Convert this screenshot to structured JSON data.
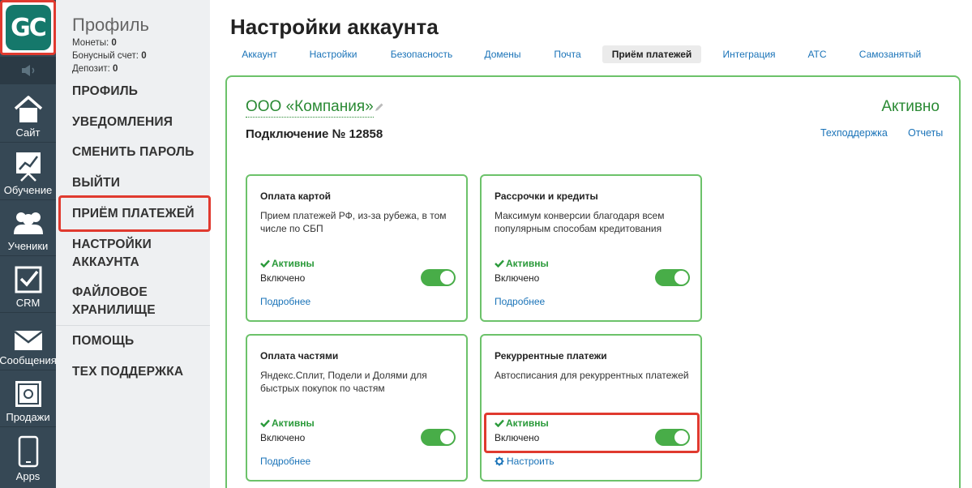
{
  "rail": {
    "logo_text": "GC",
    "items": [
      {
        "label": "Сайт",
        "icon": "house-icon"
      },
      {
        "label": "Обучение",
        "icon": "chart-board-icon"
      },
      {
        "label": "Ученики",
        "icon": "users-icon"
      },
      {
        "label": "CRM",
        "icon": "checkbox-icon"
      },
      {
        "label": "Сообщения",
        "icon": "envelope-icon"
      },
      {
        "label": "Продажи",
        "icon": "safe-icon"
      },
      {
        "label": "Apps",
        "icon": "smartphone-icon"
      }
    ]
  },
  "subnav": {
    "title": "Профиль",
    "coins_label": "Монеты:",
    "coins_value": "0",
    "bonus_label": "Бонусный счет:",
    "bonus_value": "0",
    "deposit_label": "Депозит:",
    "deposit_value": "0",
    "links": [
      "Профиль",
      "Уведомления",
      "Сменить пароль",
      "Выйти",
      "Приём платежей",
      "Настройки аккаунта",
      "Файловое хранилище",
      "Помощь",
      "Тех поддержка"
    ]
  },
  "main": {
    "title": "Настройки аккаунта",
    "tabs": [
      "Аккаунт",
      "Настройки",
      "Безопасность",
      "Домены",
      "Почта",
      "Приём платежей",
      "Интеграция",
      "АТС",
      "Самозанятый"
    ],
    "active_tab": "Приём платежей",
    "company": "ООО «Компания»",
    "status": "Активно",
    "connection": "Подключение № 12858",
    "support_link": "Техподдержка",
    "reports_link": "Отчеты"
  },
  "cards": [
    {
      "title": "Оплата картой",
      "desc": "Прием платежей РФ, из-за рубежа, в том числе по СБП",
      "active": "Активны",
      "state": "Включено",
      "link": "Подробнее",
      "enabled": true
    },
    {
      "title": "Рассрочки и кредиты",
      "desc": "Максимум конверсии благодаря всем популярным способам кредитования",
      "active": "Активны",
      "state": "Включено",
      "link": "Подробнее",
      "enabled": true
    },
    {
      "title": "Оплата частями",
      "desc": "Яндекс.Сплит, Подели и Долями для быстрых покупок по частям",
      "active": "Активны",
      "state": "Включено",
      "link": "Подробнее",
      "enabled": true
    },
    {
      "title": "Рекуррентные платежи",
      "desc": "Автосписания для рекуррентных платежей",
      "active": "Активны",
      "state": "Включено",
      "link": "Настроить",
      "enabled": true
    }
  ],
  "colors": {
    "rail_bg": "#364855",
    "accent_green": "#2a8a34",
    "toggle_on": "#48ad48",
    "highlight_red": "#e03a2f",
    "link_blue": "#1a73b8"
  }
}
